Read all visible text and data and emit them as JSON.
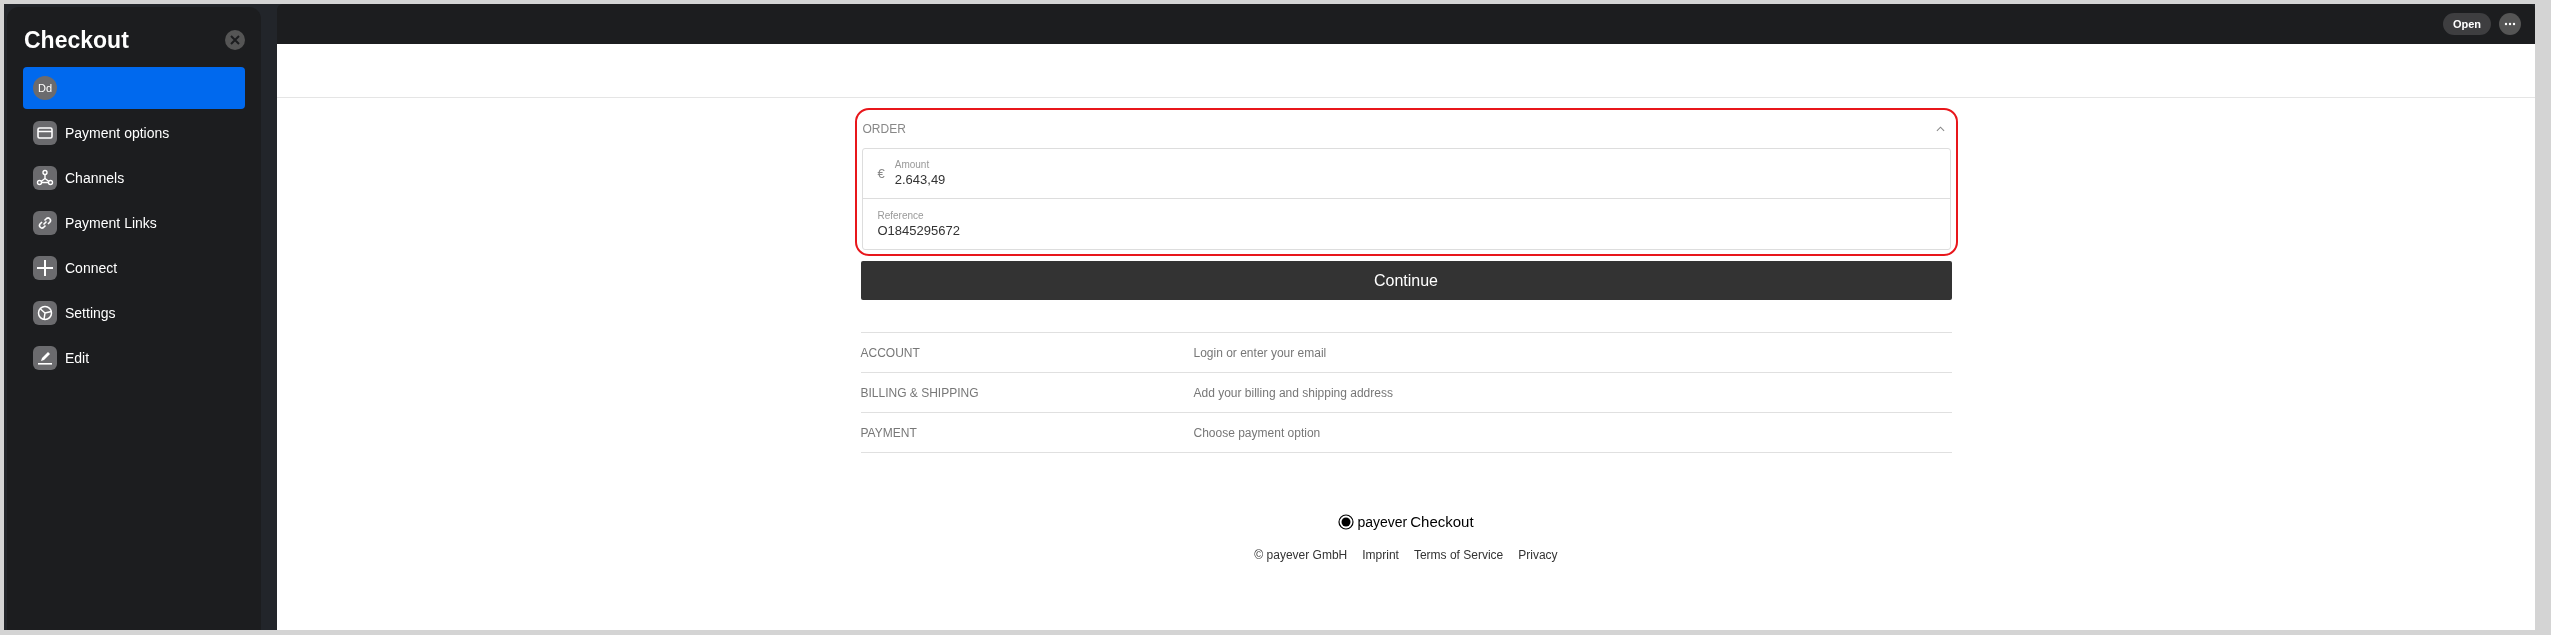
{
  "sidebar": {
    "title": "Checkout",
    "items": [
      {
        "kind": "avatar",
        "avatar": "Dd",
        "selected": true
      },
      {
        "kind": "card",
        "label": "Payment options",
        "selected": false
      },
      {
        "kind": "channels",
        "label": "Channels",
        "selected": false
      },
      {
        "kind": "link",
        "label": "Payment Links",
        "selected": false
      },
      {
        "kind": "plus",
        "label": "Connect",
        "selected": false
      },
      {
        "kind": "settings",
        "label": "Settings",
        "selected": false
      },
      {
        "kind": "edit",
        "label": "Edit",
        "selected": false
      }
    ]
  },
  "toolbar": {
    "open_button": "Open"
  },
  "order": {
    "title": "ORDER",
    "expanded": true,
    "amount": {
      "currency": "€",
      "label": "Amount",
      "value": "2.643,49"
    },
    "reference": {
      "label": "Reference",
      "value": "O1845295672"
    },
    "continue_button": "Continue"
  },
  "steps": [
    {
      "title": "ACCOUNT",
      "description": "Login or enter your email"
    },
    {
      "title": "BILLING & SHIPPING",
      "description": "Add your billing and shipping address"
    },
    {
      "title": "PAYMENT",
      "description": "Choose payment option"
    }
  ],
  "footer": {
    "brand": "payever",
    "product": "Checkout",
    "links": [
      "© payever GmbH",
      "Imprint",
      "Terms of Service",
      "Privacy"
    ]
  }
}
